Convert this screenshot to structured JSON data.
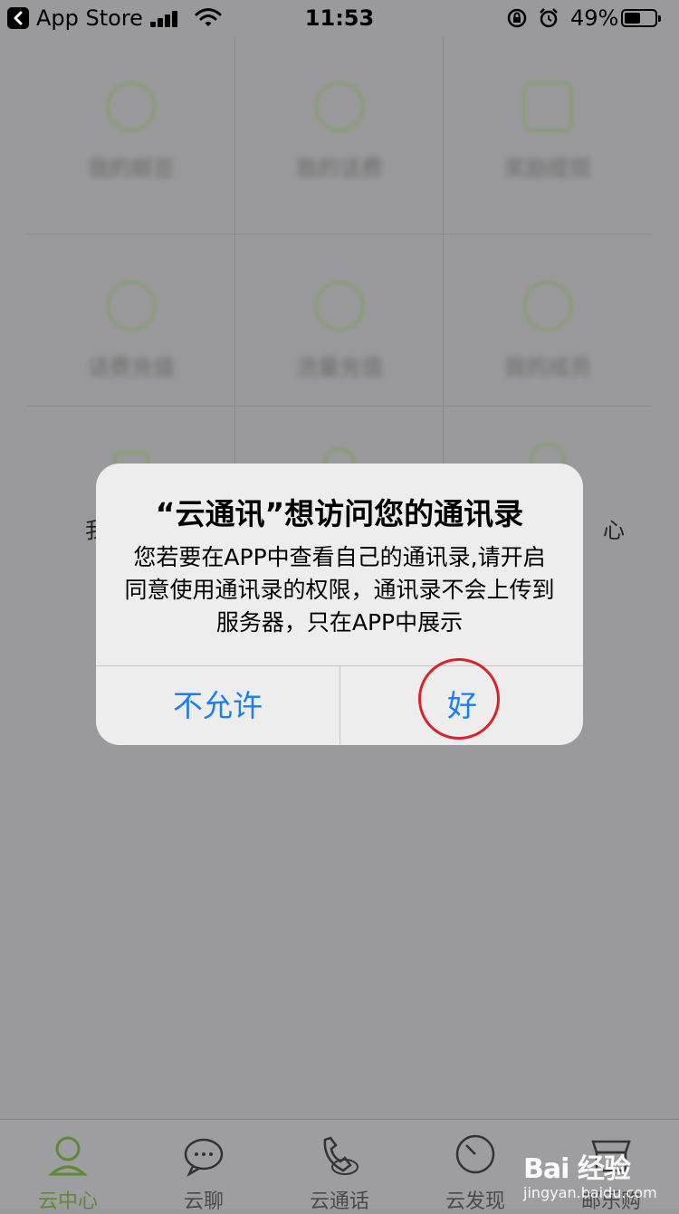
{
  "status_bar": {
    "back_label": "App Store",
    "time": "11:53",
    "battery": "49%",
    "battery_level": 0.49
  },
  "grid": {
    "items": [
      {
        "label": "我的邮豆",
        "icon": "account-icon"
      },
      {
        "label": "我的话费",
        "icon": "phone-bill-icon"
      },
      {
        "label": "奖励提现",
        "icon": "gift-icon"
      },
      {
        "label": "话费充值",
        "icon": "recharge-icon"
      },
      {
        "label": "流量充值",
        "icon": "data-icon"
      },
      {
        "label": "我的成员",
        "icon": "members-icon"
      },
      {
        "label": "我",
        "icon": "wallet-icon"
      },
      {
        "label": "",
        "icon": "money-icon"
      },
      {
        "label": "心",
        "icon": "settings-icon"
      }
    ]
  },
  "dialog": {
    "title": "“云通讯”想访问您的通讯录",
    "message": "您若要在APP中查看自己的通讯录,请开启同意使用通讯录的权限，通讯录不会上传到服务器，只在APP中展示",
    "deny_label": "不允许",
    "ok_label": "好"
  },
  "tab_bar": {
    "tabs": [
      {
        "label": "云中心",
        "icon": "user-icon",
        "active": true
      },
      {
        "label": "云聊",
        "icon": "chat-bubble-icon",
        "active": false
      },
      {
        "label": "云通话",
        "icon": "phone-icon",
        "active": false
      },
      {
        "label": "云发现",
        "icon": "compass-icon",
        "active": false
      },
      {
        "label": "邮乐购",
        "icon": "shop-icon",
        "active": false
      }
    ]
  },
  "watermark": {
    "main": "Bai 经验",
    "sub": "jingyan.baidu.com"
  },
  "colors": {
    "accent": "#1a7ef0",
    "highlight": "#d9232a",
    "active_tab": "#5d8a3a"
  }
}
